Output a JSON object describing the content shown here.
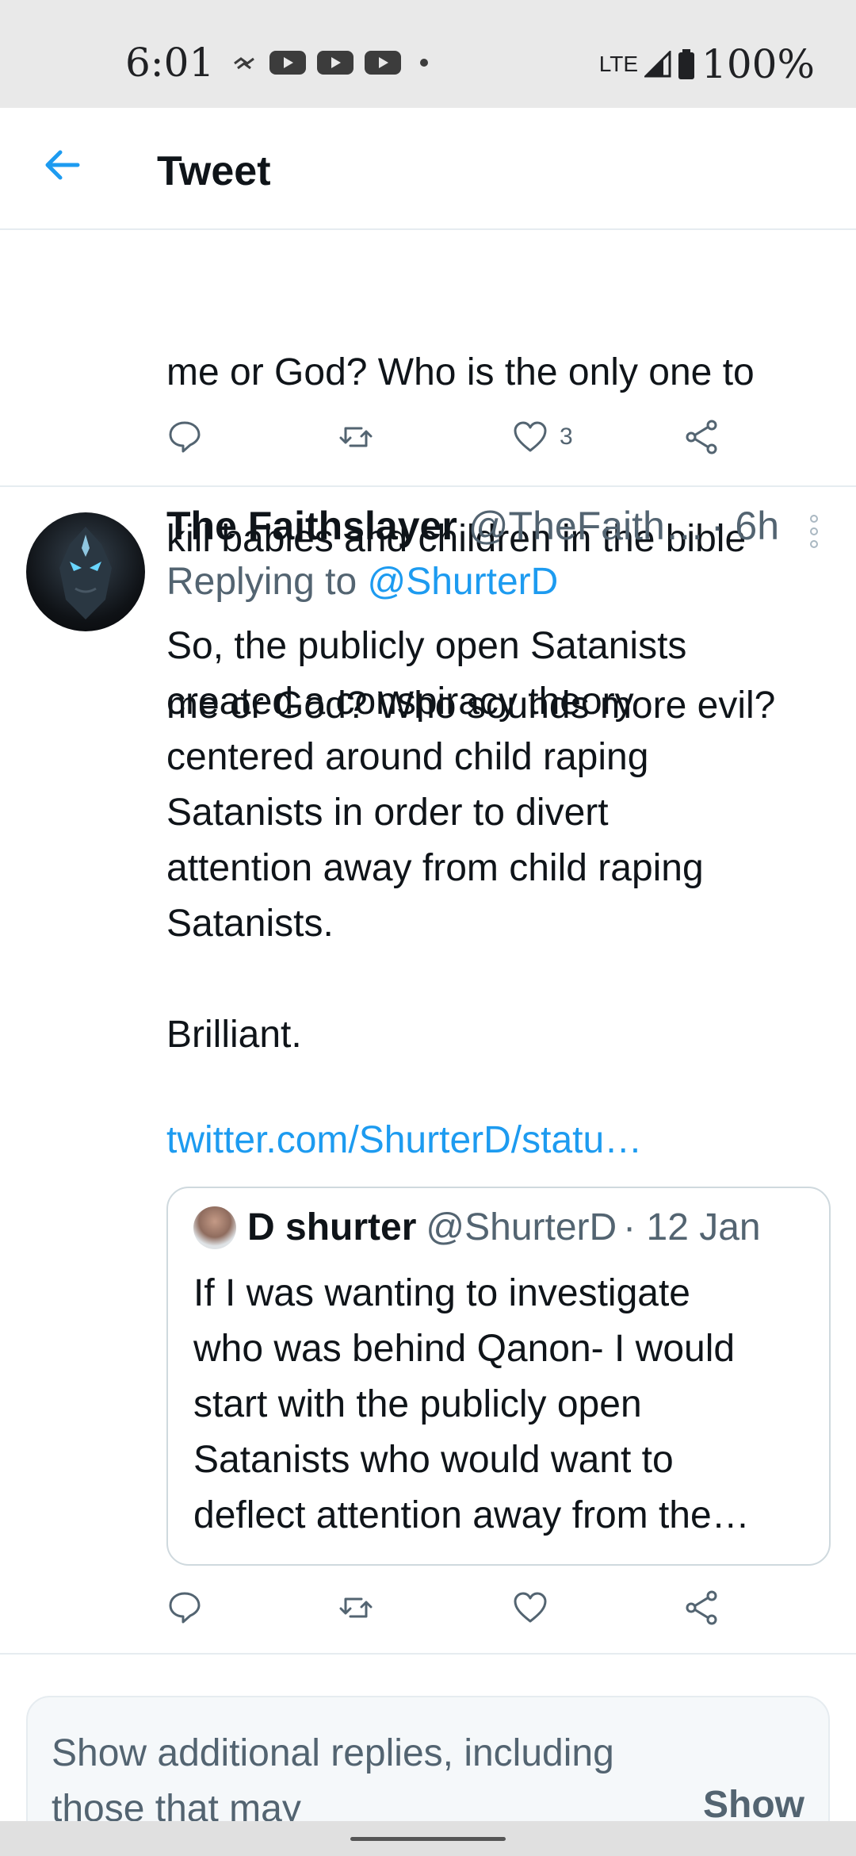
{
  "status_bar": {
    "time": "6:01",
    "network": "LTE",
    "battery": "100%"
  },
  "header": {
    "title": "Tweet"
  },
  "previous_tweet": {
    "text_lines": [
      "me or God? Who is the only one to",
      "kill babies and children in the bible",
      "me or God? Who sounds more evil?"
    ],
    "like_count": "3"
  },
  "tweet": {
    "author_name": "The Faithslayer",
    "author_handle": "@TheFaith…",
    "time": "· 6h",
    "replying_prefix": "Replying to ",
    "replying_handle": "@ShurterD",
    "body": "So, the publicly open Satanists\ncreated a conspiracy theory\ncentered around child raping\nSatanists in order to divert\nattention away from child raping\nSatanists.\n\nBrilliant.",
    "link": "twitter.com/ShurterD/statu…"
  },
  "quoted_tweet": {
    "author_name": "D shurter",
    "author_handle": "@ShurterD",
    "time": "· 12 Jan",
    "lines": [
      "If I was wanting to investigate",
      "who was behind Qanon- I would",
      "start with the publicly open",
      "Satanists who would want to",
      "deflect attention away from the…"
    ]
  },
  "show_more": {
    "text": "Show additional replies, including those that may",
    "button": "Show"
  },
  "icons": {
    "back": "arrow-left-icon",
    "reply": "comment-bubble-icon",
    "retweet": "retweet-icon",
    "like": "heart-icon",
    "share": "share-icon",
    "more": "vertical-ellipsis-icon"
  },
  "colors": {
    "accent": "#1d9bf0",
    "secondary_text": "#536471",
    "text": "#0f1419"
  }
}
